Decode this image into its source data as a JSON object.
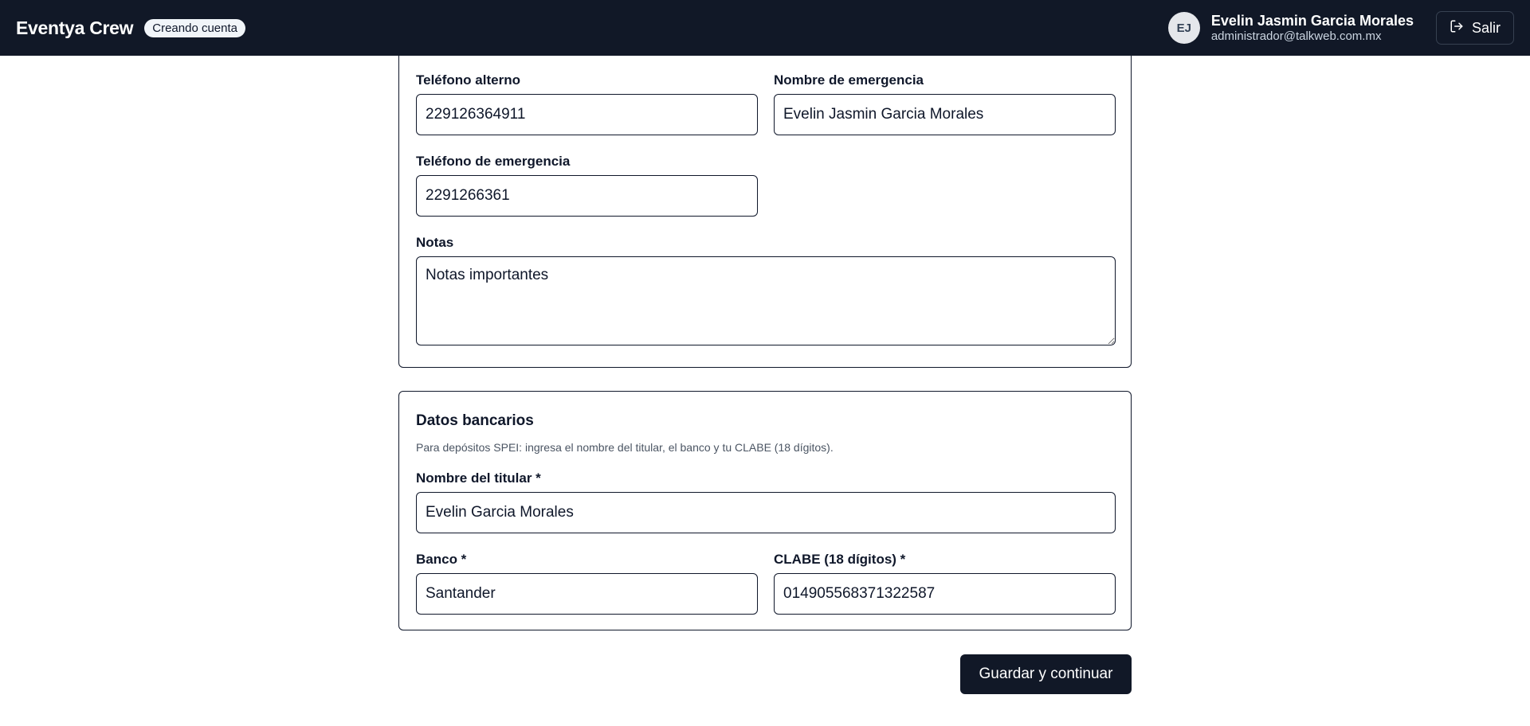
{
  "header": {
    "brand": "Eventya Crew",
    "status_badge": "Creando cuenta",
    "user": {
      "initials": "EJ",
      "name": "Evelin Jasmin Garcia Morales",
      "email": "administrador@talkweb.com.mx"
    },
    "logout_label": "Salir"
  },
  "personal": {
    "alt_phone": {
      "label": "Teléfono alterno",
      "value": "229126364911"
    },
    "emergency_name": {
      "label": "Nombre de emergencia",
      "value": "Evelin Jasmin Garcia Morales"
    },
    "emergency_phone": {
      "label": "Teléfono de emergencia",
      "value": "2291266361"
    },
    "notes": {
      "label": "Notas",
      "value": "Notas importantes"
    }
  },
  "bank": {
    "title": "Datos bancarios",
    "hint": "Para depósitos SPEI: ingresa el nombre del titular, el banco y tu CLABE (18 dígitos).",
    "holder": {
      "label": "Nombre del titular *",
      "value": "Evelin Garcia Morales"
    },
    "bank_name": {
      "label": "Banco *",
      "value": "Santander"
    },
    "clabe": {
      "label": "CLABE (18 dígitos) *",
      "value": "014905568371322587"
    }
  },
  "actions": {
    "submit_label": "Guardar y continuar"
  }
}
